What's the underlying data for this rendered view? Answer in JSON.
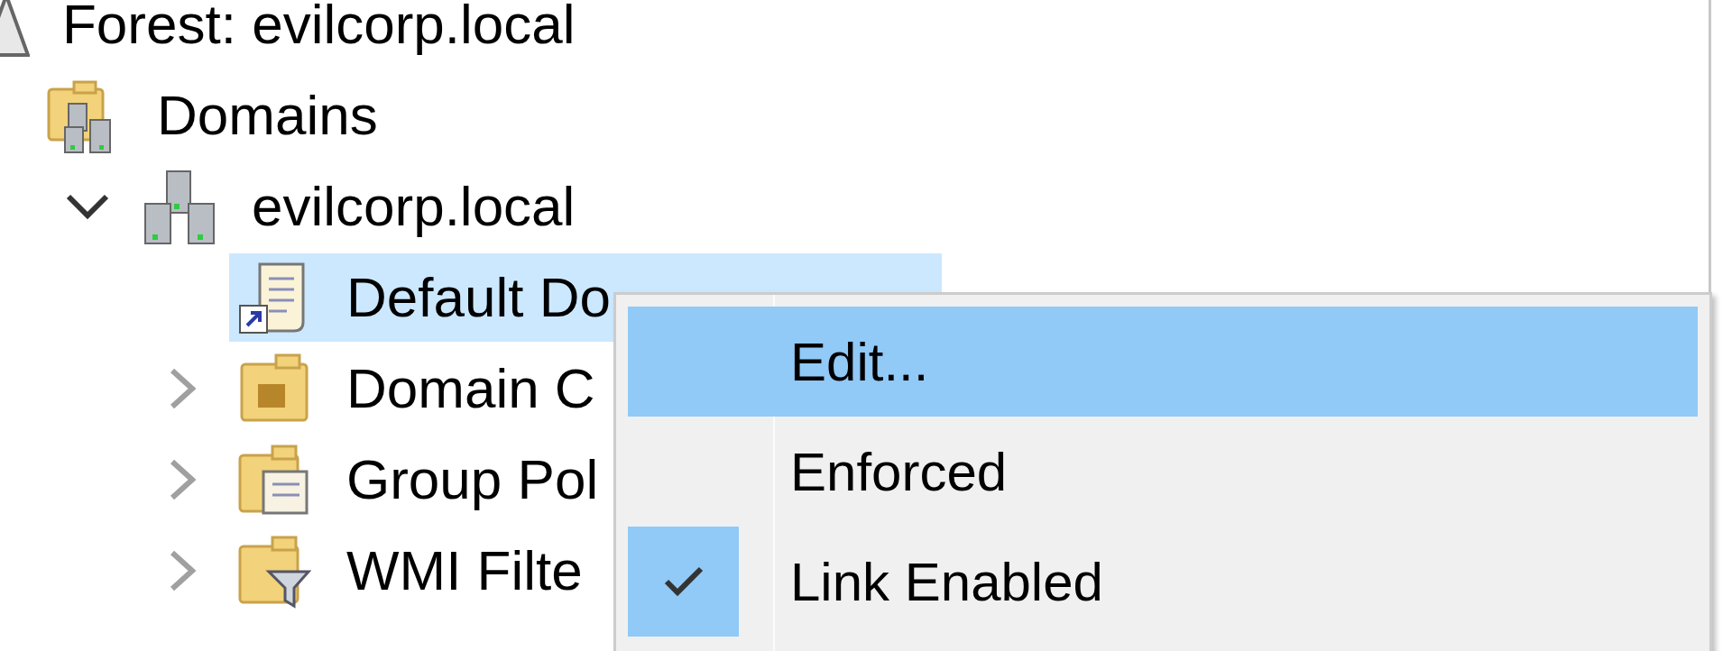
{
  "tree": [
    {
      "label": "Forest: evilcorp.local",
      "kind": "forest",
      "selected": false,
      "children": [
        {
          "label": "Domains",
          "kind": "domains",
          "selected": false,
          "children": [
            {
              "label": "evilcorp.local",
              "kind": "domain",
              "selected": false,
              "expanded": true,
              "children": [
                {
                  "label": "Default Do",
                  "kind": "link",
                  "selected": true
                },
                {
                  "label": "Domain C",
                  "kind": "ou",
                  "selected": false,
                  "expanded": false
                },
                {
                  "label": "Group Pol",
                  "kind": "objects",
                  "selected": false,
                  "expanded": false
                },
                {
                  "label": "WMI Filte",
                  "kind": "filters",
                  "selected": false,
                  "expanded": false
                }
              ]
            }
          ]
        }
      ]
    }
  ],
  "context_menu": {
    "items": [
      {
        "label": "Edit...",
        "selected": true,
        "checked": false
      },
      {
        "label": "Enforced",
        "selected": false,
        "checked": false
      },
      {
        "label": "Link Enabled",
        "selected": false,
        "checked": true
      }
    ]
  }
}
